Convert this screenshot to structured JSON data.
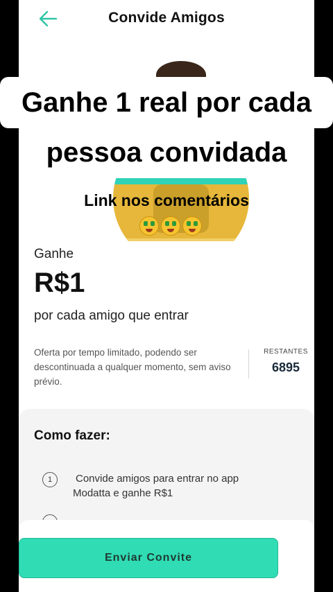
{
  "app": {
    "title": "Convide Amigos"
  },
  "overlay": {
    "line1": "Ganhe 1 real por cada",
    "line2": "pessoa convidada",
    "link": "Link nos comentários"
  },
  "offer": {
    "ganhe": "Ganhe",
    "amount": "R$1",
    "per": "por cada amigo que entrar",
    "note": "Oferta por tempo limitado, podendo ser descontinuada a qualquer momento, sem aviso prévio.",
    "remaining_label": "RESTANTES",
    "remaining_value": "6895"
  },
  "how": {
    "title": "Como fazer:",
    "steps": [
      {
        "num": "1",
        "line1": "Convide amigos para entrar no app",
        "line2": "Modatta e ganhe R$1"
      }
    ]
  },
  "cta": {
    "label": "Enviar Convite"
  },
  "colors": {
    "accent": "#30dcb4",
    "back_arrow": "#2fc5a5"
  },
  "icons": {
    "back": "arrow-left-icon",
    "emoji": "money-mouth-face-icon"
  }
}
